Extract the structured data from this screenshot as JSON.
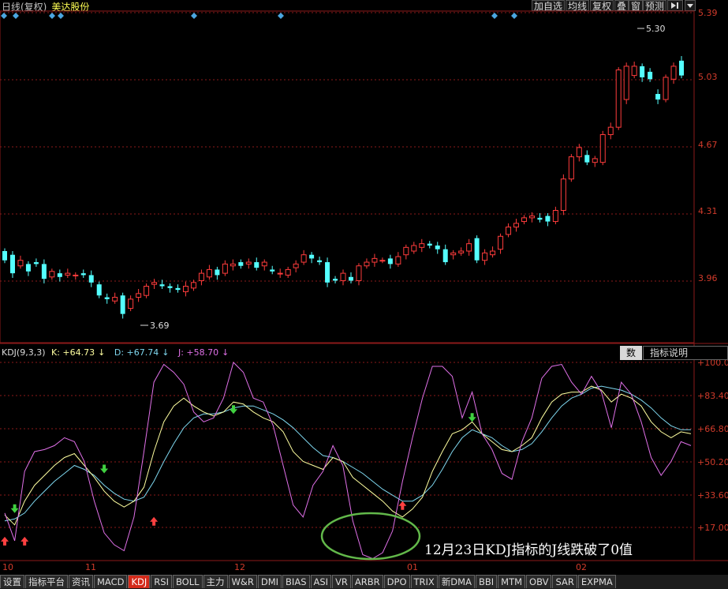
{
  "header": {
    "period": "日线(复权)",
    "stock_name": "美达股份",
    "buttons": [
      "加自选",
      "均线",
      "复权",
      "叠",
      "窗",
      "预测"
    ],
    "nav_icon": "pin-right-icon",
    "dropdown_icon": "triangle-down-icon"
  },
  "price_axis": {
    "labels": [
      "5.39",
      "5.03",
      "4.67",
      "4.31",
      "3.96"
    ],
    "high_label": "5.30",
    "low_label": "3.69"
  },
  "kdj": {
    "name": "KDJ(9,3,3)",
    "k": "K: +64.73",
    "d": "D: +67.74",
    "j": "J: +58.70",
    "arrow_icon": "arrow-down-icon",
    "axis_labels": [
      "+100.0",
      "+83.40",
      "+66.80",
      "+50.20",
      "+33.60",
      "+17.00"
    ],
    "colors": {
      "k": "#ffffa0",
      "d": "#7fd8f0",
      "j": "#e070e8"
    }
  },
  "panel_buttons": {
    "data": "数",
    "explain": "指标说明"
  },
  "x_axis": {
    "labels": [
      "10",
      "11",
      "12",
      "01",
      "02"
    ]
  },
  "annotation": "12月23日KDJ指标的J线跌破了0值",
  "tabs": [
    "设置",
    "指标平台",
    "资讯",
    "MACD",
    "KDJ",
    "RSI",
    "BOLL",
    "主力",
    "W&R",
    "DMI",
    "BIAS",
    "ASI",
    "VR",
    "ARBR",
    "DPO",
    "TRIX",
    "新DMA",
    "BBI",
    "MTM",
    "OBV",
    "SAR",
    "EXPMA"
  ],
  "active_tab": "KDJ",
  "colors": {
    "up": "#ff3c3c",
    "down": "#54ffff",
    "axis": "#d23b2b",
    "grid": "#8b1a1a",
    "circle": "#62b84a"
  },
  "chart_data": {
    "type": "candlestick+line",
    "price_ylim": [
      3.69,
      5.39
    ],
    "candles_open_close": [
      [
        4.1,
        4.05
      ],
      [
        4.08,
        3.98
      ],
      [
        4.02,
        4.05
      ],
      [
        4.03,
        3.99
      ],
      [
        4.04,
        4.03
      ],
      [
        4.03,
        3.95
      ],
      [
        3.96,
        3.99
      ],
      [
        3.98,
        3.96
      ],
      [
        3.97,
        3.98
      ],
      [
        3.97,
        3.97
      ],
      [
        3.98,
        3.97
      ],
      [
        3.97,
        3.93
      ],
      [
        3.92,
        3.86
      ],
      [
        3.85,
        3.84
      ],
      [
        3.83,
        3.85
      ],
      [
        3.86,
        3.76
      ],
      [
        3.79,
        3.84
      ],
      [
        3.85,
        3.87
      ],
      [
        3.86,
        3.91
      ],
      [
        3.92,
        3.93
      ],
      [
        3.92,
        3.91
      ],
      [
        3.91,
        3.9
      ],
      [
        3.9,
        3.89
      ],
      [
        3.88,
        3.91
      ],
      [
        3.9,
        3.93
      ],
      [
        3.94,
        3.98
      ],
      [
        3.96,
        4
      ],
      [
        4,
        3.97
      ],
      [
        3.98,
        4.03
      ],
      [
        4.02,
        4.03
      ],
      [
        4.04,
        4.02
      ],
      [
        4.03,
        4.04
      ],
      [
        4.04,
        4.01
      ],
      [
        4.02,
        4.04
      ],
      [
        4,
        3.99
      ],
      [
        3.98,
        3.98
      ],
      [
        3.97,
        4
      ],
      [
        4.01,
        4.03
      ],
      [
        4.04,
        4.08
      ],
      [
        4.08,
        4.06
      ],
      [
        4.05,
        4.04
      ],
      [
        4.04,
        3.93
      ],
      [
        3.95,
        3.94
      ],
      [
        3.94,
        3.98
      ],
      [
        3.96,
        3.94
      ],
      [
        3.94,
        4.02
      ],
      [
        4.02,
        4.04
      ],
      [
        4.04,
        4.06
      ],
      [
        4.05,
        4.05
      ],
      [
        4.06,
        4.03
      ],
      [
        4.03,
        4.07
      ],
      [
        4.08,
        4.12
      ],
      [
        4.1,
        4.13
      ],
      [
        4.12,
        4.14
      ],
      [
        4.14,
        4.13
      ],
      [
        4.13,
        4.11
      ],
      [
        4.11,
        4.04
      ],
      [
        4.08,
        4.09
      ],
      [
        4.09,
        4.1
      ],
      [
        4.1,
        4.14
      ],
      [
        4.17,
        4.05
      ],
      [
        4.05,
        4.09
      ],
      [
        4.08,
        4.1
      ],
      [
        4.11,
        4.18
      ],
      [
        4.19,
        4.23
      ],
      [
        4.23,
        4.25
      ],
      [
        4.26,
        4.28
      ],
      [
        4.28,
        4.29
      ],
      [
        4.28,
        4.27
      ],
      [
        4.29,
        4.26
      ],
      [
        4.26,
        4.32
      ],
      [
        4.32,
        4.49
      ],
      [
        4.49,
        4.61
      ],
      [
        4.61,
        4.66
      ],
      [
        4.62,
        4.58
      ],
      [
        4.58,
        4.6
      ],
      [
        4.58,
        4.73
      ],
      [
        4.73,
        4.77
      ],
      [
        4.77,
        5.08
      ],
      [
        4.92,
        5.1
      ],
      [
        5.05,
        5.1
      ],
      [
        5.1,
        5.04
      ],
      [
        5.07,
        5.03
      ],
      [
        4.95,
        4.92
      ],
      [
        4.92,
        5.04
      ],
      [
        5.03,
        5.1
      ],
      [
        5.13,
        5.05
      ]
    ],
    "kdj_scale": [
      0,
      100
    ],
    "k_series": [
      [
        0,
        23
      ],
      [
        1,
        18
      ],
      [
        2,
        30
      ],
      [
        3,
        38
      ],
      [
        4,
        43
      ],
      [
        5,
        48
      ],
      [
        6,
        52
      ],
      [
        7,
        54
      ],
      [
        8,
        48
      ],
      [
        9,
        42
      ],
      [
        10,
        35
      ],
      [
        11,
        30
      ],
      [
        12,
        27
      ],
      [
        13,
        30
      ],
      [
        14,
        37
      ],
      [
        15,
        55
      ],
      [
        16,
        70
      ],
      [
        17,
        78
      ],
      [
        18,
        82
      ],
      [
        19,
        78
      ],
      [
        20,
        75
      ],
      [
        21,
        73
      ],
      [
        22,
        75
      ],
      [
        23,
        80
      ],
      [
        24,
        79
      ],
      [
        25,
        75
      ],
      [
        26,
        72
      ],
      [
        27,
        70
      ],
      [
        28,
        65
      ],
      [
        29,
        55
      ],
      [
        30,
        50
      ],
      [
        31,
        48
      ],
      [
        32,
        46
      ],
      [
        33,
        52
      ],
      [
        34,
        50
      ],
      [
        35,
        42
      ],
      [
        36,
        38
      ],
      [
        37,
        34
      ],
      [
        38,
        30
      ],
      [
        39,
        25
      ],
      [
        40,
        22
      ],
      [
        41,
        26
      ],
      [
        42,
        32
      ],
      [
        43,
        45
      ],
      [
        44,
        55
      ],
      [
        45,
        64
      ],
      [
        46,
        66
      ],
      [
        47,
        70
      ],
      [
        48,
        64
      ],
      [
        49,
        60
      ],
      [
        50,
        56
      ],
      [
        51,
        55
      ],
      [
        52,
        58
      ],
      [
        53,
        62
      ],
      [
        54,
        72
      ],
      [
        55,
        80
      ],
      [
        56,
        84
      ],
      [
        57,
        85
      ],
      [
        58,
        85
      ],
      [
        59,
        88
      ],
      [
        60,
        86
      ],
      [
        61,
        80
      ],
      [
        62,
        84
      ],
      [
        63,
        82
      ],
      [
        64,
        78
      ],
      [
        65,
        70
      ],
      [
        66,
        65
      ],
      [
        67,
        62
      ],
      [
        68,
        65
      ],
      [
        69,
        64
      ]
    ],
    "d_series": [
      [
        0,
        20
      ],
      [
        1,
        21
      ],
      [
        2,
        24
      ],
      [
        3,
        30
      ],
      [
        4,
        35
      ],
      [
        5,
        40
      ],
      [
        6,
        44
      ],
      [
        7,
        48
      ],
      [
        8,
        46
      ],
      [
        9,
        43
      ],
      [
        10,
        38
      ],
      [
        11,
        34
      ],
      [
        12,
        31
      ],
      [
        13,
        30
      ],
      [
        14,
        32
      ],
      [
        15,
        40
      ],
      [
        16,
        50
      ],
      [
        17,
        59
      ],
      [
        18,
        67
      ],
      [
        19,
        72
      ],
      [
        20,
        74
      ],
      [
        21,
        74
      ],
      [
        22,
        75
      ],
      [
        23,
        77
      ],
      [
        24,
        78
      ],
      [
        25,
        78
      ],
      [
        26,
        76
      ],
      [
        27,
        74
      ],
      [
        28,
        71
      ],
      [
        29,
        67
      ],
      [
        30,
        62
      ],
      [
        31,
        57
      ],
      [
        32,
        53
      ],
      [
        33,
        52
      ],
      [
        34,
        50
      ],
      [
        35,
        47
      ],
      [
        36,
        44
      ],
      [
        37,
        40
      ],
      [
        38,
        36
      ],
      [
        39,
        33
      ],
      [
        40,
        30
      ],
      [
        41,
        30
      ],
      [
        42,
        33
      ],
      [
        43,
        38
      ],
      [
        44,
        46
      ],
      [
        45,
        55
      ],
      [
        46,
        62
      ],
      [
        47,
        66
      ],
      [
        48,
        64
      ],
      [
        49,
        62
      ],
      [
        50,
        58
      ],
      [
        51,
        55
      ],
      [
        52,
        56
      ],
      [
        53,
        59
      ],
      [
        54,
        65
      ],
      [
        55,
        72
      ],
      [
        56,
        78
      ],
      [
        57,
        82
      ],
      [
        58,
        84
      ],
      [
        59,
        87
      ],
      [
        60,
        88
      ],
      [
        61,
        87
      ],
      [
        62,
        86
      ],
      [
        63,
        84
      ],
      [
        64,
        81
      ],
      [
        65,
        77
      ],
      [
        66,
        72
      ],
      [
        67,
        68
      ],
      [
        68,
        66
      ],
      [
        69,
        66
      ]
    ],
    "j_series": [
      [
        0,
        24
      ],
      [
        1,
        10
      ],
      [
        2,
        45
      ],
      [
        3,
        55
      ],
      [
        4,
        56
      ],
      [
        5,
        58
      ],
      [
        6,
        62
      ],
      [
        7,
        60
      ],
      [
        8,
        50
      ],
      [
        9,
        30
      ],
      [
        10,
        14
      ],
      [
        11,
        8
      ],
      [
        12,
        5
      ],
      [
        13,
        22
      ],
      [
        14,
        55
      ],
      [
        15,
        90
      ],
      [
        16,
        99
      ],
      [
        17,
        95
      ],
      [
        18,
        89
      ],
      [
        19,
        75
      ],
      [
        20,
        70
      ],
      [
        21,
        72
      ],
      [
        22,
        82
      ],
      [
        23,
        100
      ],
      [
        24,
        95
      ],
      [
        25,
        82
      ],
      [
        26,
        80
      ],
      [
        27,
        68
      ],
      [
        28,
        48
      ],
      [
        29,
        28
      ],
      [
        30,
        22
      ],
      [
        31,
        38
      ],
      [
        32,
        45
      ],
      [
        33,
        58
      ],
      [
        34,
        48
      ],
      [
        35,
        20
      ],
      [
        36,
        3
      ],
      [
        37,
        1
      ],
      [
        38,
        4
      ],
      [
        39,
        15
      ],
      [
        40,
        40
      ],
      [
        41,
        62
      ],
      [
        42,
        82
      ],
      [
        43,
        98
      ],
      [
        44,
        98
      ],
      [
        45,
        93
      ],
      [
        46,
        72
      ],
      [
        47,
        85
      ],
      [
        48,
        64
      ],
      [
        49,
        56
      ],
      [
        50,
        44
      ],
      [
        51,
        41
      ],
      [
        52,
        60
      ],
      [
        53,
        72
      ],
      [
        54,
        92
      ],
      [
        55,
        98
      ],
      [
        56,
        99
      ],
      [
        57,
        90
      ],
      [
        58,
        84
      ],
      [
        59,
        93
      ],
      [
        60,
        85
      ],
      [
        61,
        67
      ],
      [
        62,
        90
      ],
      [
        63,
        84
      ],
      [
        64,
        70
      ],
      [
        65,
        52
      ],
      [
        66,
        43
      ],
      [
        67,
        50
      ],
      [
        68,
        60
      ],
      [
        69,
        58
      ]
    ]
  }
}
